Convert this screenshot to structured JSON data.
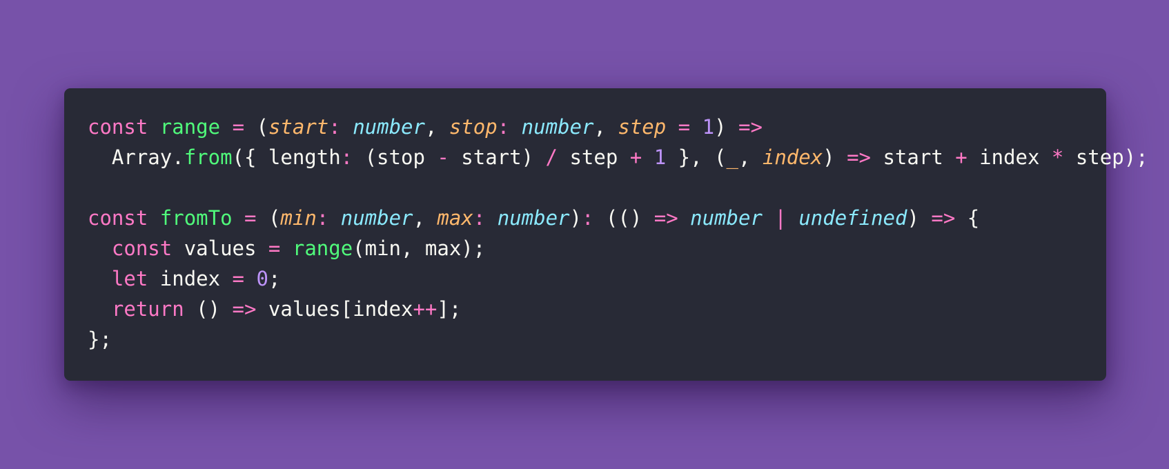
{
  "colors": {
    "background": "#7752a9",
    "editor_background": "#282a36",
    "keyword": "#ff79c6",
    "function": "#50fa7b",
    "parameter": "#ffb86c",
    "type": "#8be9fd",
    "number": "#bd93f9",
    "text": "#f8f8f2"
  },
  "code": {
    "lines": [
      [
        {
          "t": "const",
          "c": "kw"
        },
        {
          "t": " ",
          "c": "plain"
        },
        {
          "t": "range",
          "c": "fn"
        },
        {
          "t": " ",
          "c": "plain"
        },
        {
          "t": "=",
          "c": "op"
        },
        {
          "t": " (",
          "c": "plain"
        },
        {
          "t": "start",
          "c": "param"
        },
        {
          "t": ":",
          "c": "op"
        },
        {
          "t": " ",
          "c": "plain"
        },
        {
          "t": "number",
          "c": "type"
        },
        {
          "t": ", ",
          "c": "plain"
        },
        {
          "t": "stop",
          "c": "param"
        },
        {
          "t": ":",
          "c": "op"
        },
        {
          "t": " ",
          "c": "plain"
        },
        {
          "t": "number",
          "c": "type"
        },
        {
          "t": ", ",
          "c": "plain"
        },
        {
          "t": "step",
          "c": "param"
        },
        {
          "t": " ",
          "c": "plain"
        },
        {
          "t": "=",
          "c": "op"
        },
        {
          "t": " ",
          "c": "plain"
        },
        {
          "t": "1",
          "c": "num"
        },
        {
          "t": ") ",
          "c": "plain"
        },
        {
          "t": "=>",
          "c": "op"
        }
      ],
      [
        {
          "t": "  Array.",
          "c": "plain"
        },
        {
          "t": "from",
          "c": "fn"
        },
        {
          "t": "({ length",
          "c": "plain"
        },
        {
          "t": ":",
          "c": "op"
        },
        {
          "t": " (stop ",
          "c": "plain"
        },
        {
          "t": "-",
          "c": "op"
        },
        {
          "t": " start) ",
          "c": "plain"
        },
        {
          "t": "/",
          "c": "op"
        },
        {
          "t": " step ",
          "c": "plain"
        },
        {
          "t": "+",
          "c": "op"
        },
        {
          "t": " ",
          "c": "plain"
        },
        {
          "t": "1",
          "c": "num"
        },
        {
          "t": " }, (",
          "c": "plain"
        },
        {
          "t": "_",
          "c": "param"
        },
        {
          "t": ", ",
          "c": "plain"
        },
        {
          "t": "index",
          "c": "param"
        },
        {
          "t": ") ",
          "c": "plain"
        },
        {
          "t": "=>",
          "c": "op"
        },
        {
          "t": " start ",
          "c": "plain"
        },
        {
          "t": "+",
          "c": "op"
        },
        {
          "t": " index ",
          "c": "plain"
        },
        {
          "t": "*",
          "c": "op"
        },
        {
          "t": " step);",
          "c": "plain"
        }
      ],
      [],
      [
        {
          "t": "const",
          "c": "kw"
        },
        {
          "t": " ",
          "c": "plain"
        },
        {
          "t": "fromTo",
          "c": "fn"
        },
        {
          "t": " ",
          "c": "plain"
        },
        {
          "t": "=",
          "c": "op"
        },
        {
          "t": " (",
          "c": "plain"
        },
        {
          "t": "min",
          "c": "param"
        },
        {
          "t": ":",
          "c": "op"
        },
        {
          "t": " ",
          "c": "plain"
        },
        {
          "t": "number",
          "c": "type"
        },
        {
          "t": ", ",
          "c": "plain"
        },
        {
          "t": "max",
          "c": "param"
        },
        {
          "t": ":",
          "c": "op"
        },
        {
          "t": " ",
          "c": "plain"
        },
        {
          "t": "number",
          "c": "type"
        },
        {
          "t": ")",
          "c": "plain"
        },
        {
          "t": ":",
          "c": "op"
        },
        {
          "t": " (() ",
          "c": "plain"
        },
        {
          "t": "=>",
          "c": "op"
        },
        {
          "t": " ",
          "c": "plain"
        },
        {
          "t": "number",
          "c": "type"
        },
        {
          "t": " ",
          "c": "plain"
        },
        {
          "t": "|",
          "c": "op"
        },
        {
          "t": " ",
          "c": "plain"
        },
        {
          "t": "undefined",
          "c": "type"
        },
        {
          "t": ") ",
          "c": "plain"
        },
        {
          "t": "=>",
          "c": "op"
        },
        {
          "t": " {",
          "c": "plain"
        }
      ],
      [
        {
          "t": "  ",
          "c": "plain"
        },
        {
          "t": "const",
          "c": "kw"
        },
        {
          "t": " values ",
          "c": "plain"
        },
        {
          "t": "=",
          "c": "op"
        },
        {
          "t": " ",
          "c": "plain"
        },
        {
          "t": "range",
          "c": "fn"
        },
        {
          "t": "(min, max);",
          "c": "plain"
        }
      ],
      [
        {
          "t": "  ",
          "c": "plain"
        },
        {
          "t": "let",
          "c": "kw"
        },
        {
          "t": " index ",
          "c": "plain"
        },
        {
          "t": "=",
          "c": "op"
        },
        {
          "t": " ",
          "c": "plain"
        },
        {
          "t": "0",
          "c": "num"
        },
        {
          "t": ";",
          "c": "plain"
        }
      ],
      [
        {
          "t": "  ",
          "c": "plain"
        },
        {
          "t": "return",
          "c": "kw"
        },
        {
          "t": " () ",
          "c": "plain"
        },
        {
          "t": "=>",
          "c": "op"
        },
        {
          "t": " values[index",
          "c": "plain"
        },
        {
          "t": "++",
          "c": "op"
        },
        {
          "t": "];",
          "c": "plain"
        }
      ],
      [
        {
          "t": "};",
          "c": "plain"
        }
      ]
    ]
  }
}
